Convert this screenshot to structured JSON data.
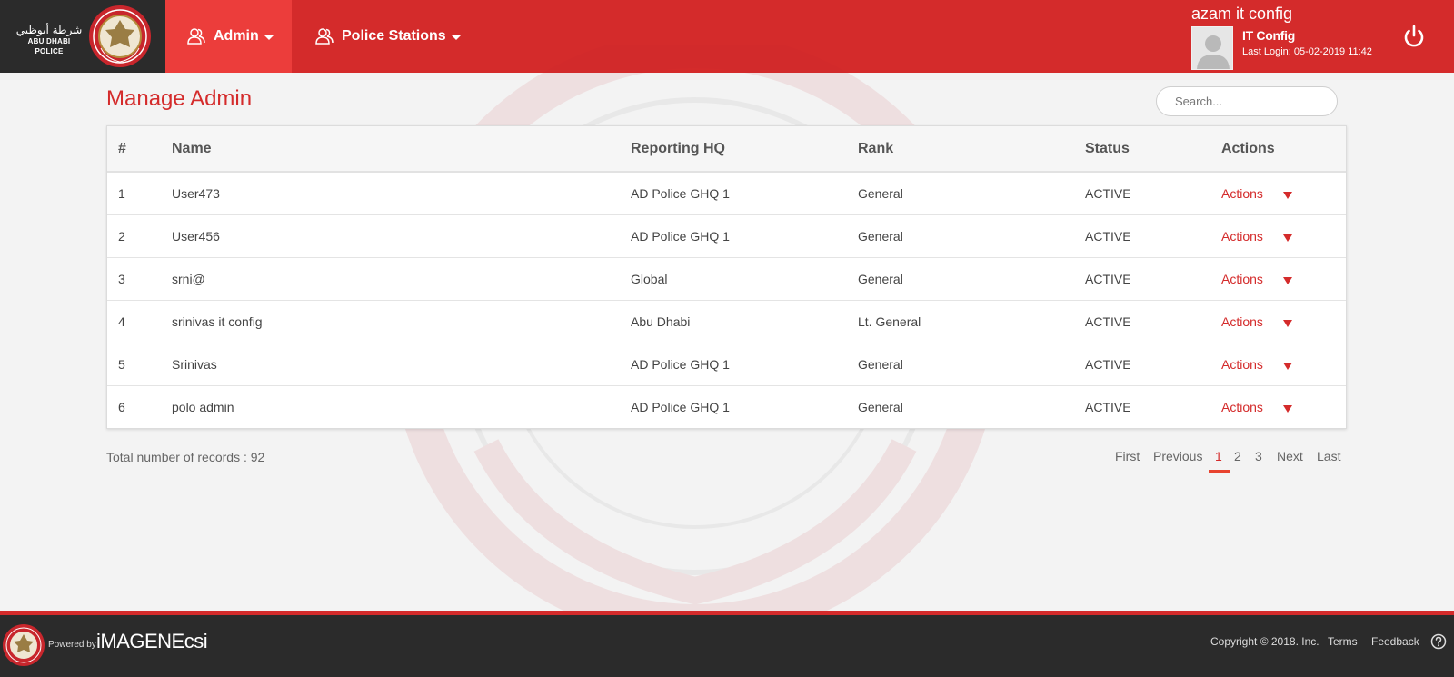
{
  "brand": {
    "arabic": "شرطة أبوظبي",
    "english": "ABU DHABI POLICE"
  },
  "nav": [
    {
      "label": "Admin",
      "icon": "users-icon"
    },
    {
      "label": "Police Stations",
      "icon": "users-icon"
    }
  ],
  "user": {
    "name": "azam it config",
    "role": "IT Config",
    "last_login": "Last Login: 05-02-2019 11:42"
  },
  "page": {
    "title": "Manage Admin",
    "search_placeholder": "Search..."
  },
  "table": {
    "columns": [
      "#",
      "Name",
      "Reporting HQ",
      "Rank",
      "Status",
      "Actions"
    ],
    "rows": [
      {
        "num": "1",
        "name": "User473",
        "hq": "AD Police GHQ 1",
        "rank": "General",
        "status": "ACTIVE",
        "action": "Actions"
      },
      {
        "num": "2",
        "name": "User456",
        "hq": "AD Police GHQ 1",
        "rank": "General",
        "status": "ACTIVE",
        "action": "Actions"
      },
      {
        "num": "3",
        "name": "srni@",
        "hq": "Global",
        "rank": "General",
        "status": "ACTIVE",
        "action": "Actions"
      },
      {
        "num": "4",
        "name": "srinivas it config",
        "hq": "Abu Dhabi",
        "rank": "Lt. General",
        "status": "ACTIVE",
        "action": "Actions"
      },
      {
        "num": "5",
        "name": "Srinivas",
        "hq": "AD Police GHQ 1",
        "rank": "General",
        "status": "ACTIVE",
        "action": "Actions"
      },
      {
        "num": "6",
        "name": "polo admin",
        "hq": "AD Police GHQ 1",
        "rank": "General",
        "status": "ACTIVE",
        "action": "Actions"
      }
    ]
  },
  "total_records": "Total number of records : 92",
  "pagination": {
    "first": "First",
    "previous": "Previous",
    "pages": [
      "1",
      "2",
      "3"
    ],
    "next": "Next",
    "last": "Last",
    "current": "1"
  },
  "footer": {
    "powered_by": "Powered by",
    "company": "iMAGENEcsi",
    "copyright": "Copyright © 2018. Inc.",
    "terms": "Terms",
    "feedback": "Feedback"
  },
  "colors": {
    "brand_red": "#d42b2b",
    "active_nav": "#ec3d3b",
    "dark": "#2b2b2b"
  }
}
